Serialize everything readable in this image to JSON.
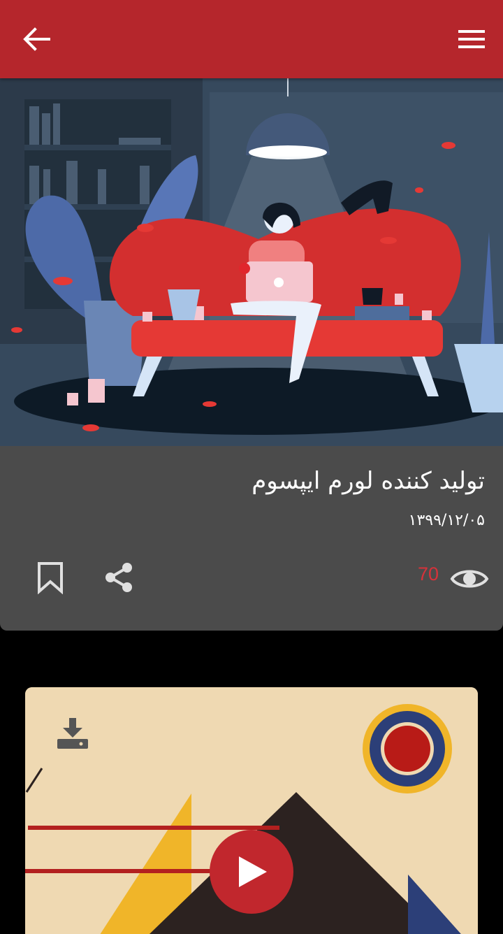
{
  "header": {
    "back_icon": "arrow-left-icon",
    "menu_icon": "hamburger-menu-icon",
    "color": "#b5262c"
  },
  "article": {
    "title": "تولید کننده لورم ایپسوم",
    "date": "۱۳۹۹/۱۲/۰۵",
    "views": "70",
    "views_color": "#d6323a",
    "bookmark_icon": "bookmark-icon",
    "share_icon": "share-icon",
    "eye_icon": "eye-icon"
  },
  "video": {
    "download_icon": "download-icon",
    "play_icon": "play-icon",
    "play_color": "#c1272d"
  }
}
